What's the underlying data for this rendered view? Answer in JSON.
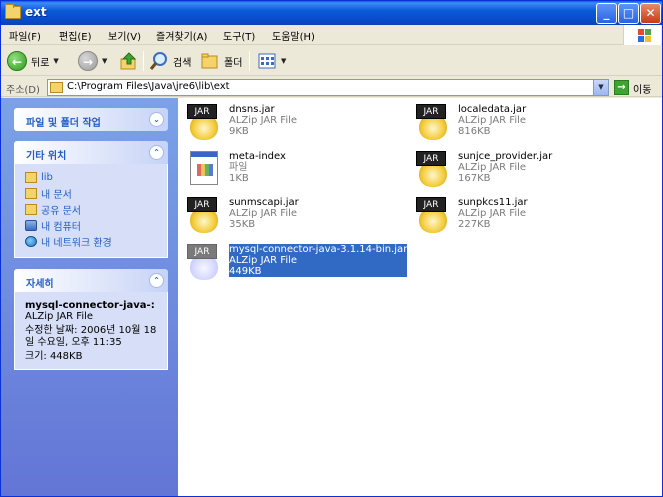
{
  "window": {
    "title": "ext",
    "minimize": "_",
    "maximize": "□",
    "close": "✕"
  },
  "menu": [
    "파일(F)",
    "편집(E)",
    "보기(V)",
    "즐겨찾기(A)",
    "도구(T)",
    "도움말(H)"
  ],
  "toolbar": {
    "back_label": "뒤로",
    "search_label": "검색",
    "folders_label": "폴더"
  },
  "address": {
    "label": "주소(D)",
    "path": "C:\\Program Files\\Java\\jre6\\lib\\ext",
    "go_label": "이동"
  },
  "sidebar": {
    "file_tasks": {
      "title": "파일 및 폴더 작업"
    },
    "other_places": {
      "title": "기타 위치",
      "items": [
        {
          "label": "lib",
          "icon": "folder-icon"
        },
        {
          "label": "내 문서",
          "icon": "folder-icon"
        },
        {
          "label": "공유 문서",
          "icon": "folder-icon"
        },
        {
          "label": "내 컴퓨터",
          "icon": "computer-icon"
        },
        {
          "label": "내 네트워크 환경",
          "icon": "network-icon"
        }
      ]
    },
    "details": {
      "title": "자세히",
      "name": "mysql-connector-java-:",
      "type": "ALZip JAR File",
      "modified_1": "수정한 날짜: 2006년 10월 18",
      "modified_2": "일 수요일, 오후 11:35",
      "size": "크기: 448KB"
    }
  },
  "files": [
    {
      "name": "dnsns.jar",
      "type": "ALZip JAR File",
      "size": "9KB",
      "icon": "jar-icon",
      "selected": false
    },
    {
      "name": "localedata.jar",
      "type": "ALZip JAR File",
      "size": "816KB",
      "icon": "jar-icon",
      "selected": false
    },
    {
      "name": "meta-index",
      "type": "파일",
      "size": "1KB",
      "icon": "file-icon",
      "selected": false
    },
    {
      "name": "sunjce_provider.jar",
      "type": "ALZip JAR File",
      "size": "167KB",
      "icon": "jar-icon",
      "selected": false
    },
    {
      "name": "sunmscapi.jar",
      "type": "ALZip JAR File",
      "size": "35KB",
      "icon": "jar-icon",
      "selected": false
    },
    {
      "name": "sunpkcs11.jar",
      "type": "ALZip JAR File",
      "size": "227KB",
      "icon": "jar-icon",
      "selected": false
    },
    {
      "name": "mysql-connector-java-3.1.14-bin.jar",
      "type": "ALZip JAR File",
      "size": "449KB",
      "icon": "jar-icon",
      "selected": true
    }
  ],
  "colors": {
    "titlebar": "#0a5fe0",
    "taskpane": "#6375d6",
    "selection": "#316ac5",
    "link": "#215dc6"
  }
}
